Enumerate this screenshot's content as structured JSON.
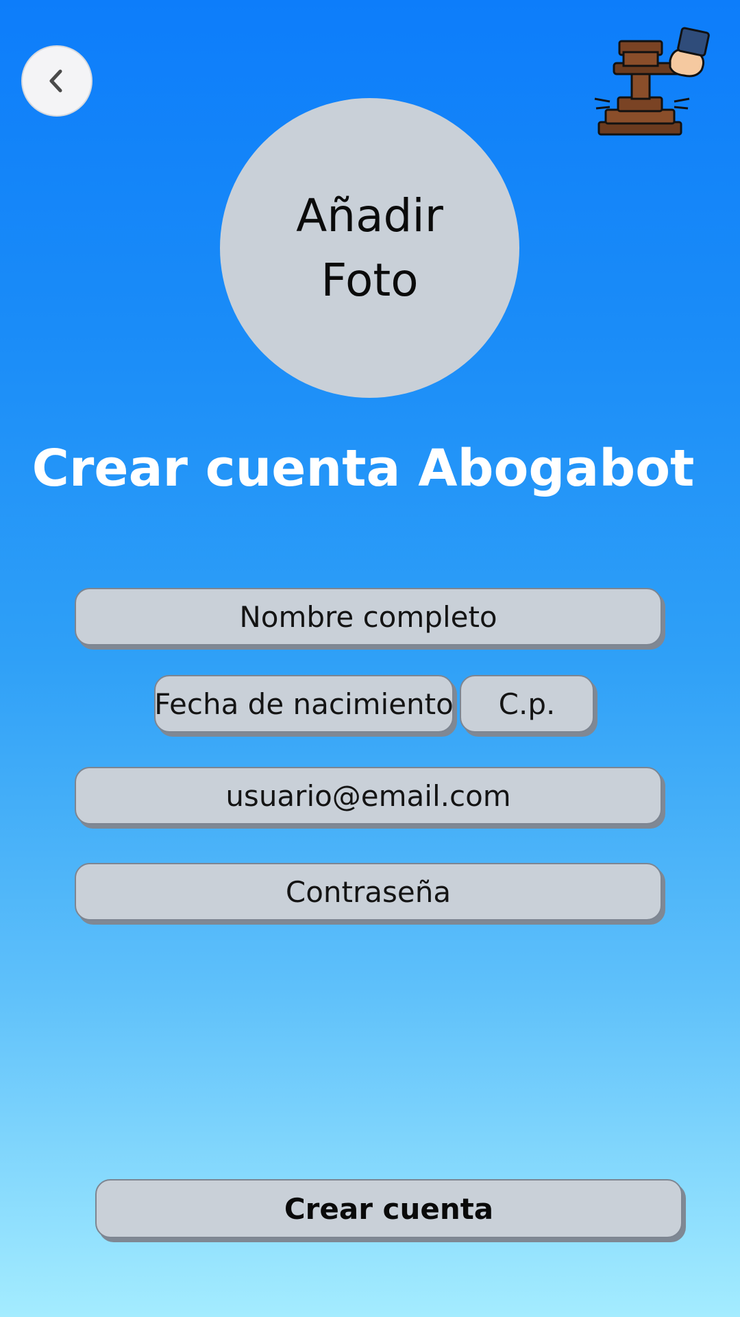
{
  "header": {
    "back_icon": "chevron-left-icon",
    "logo_icon": "gavel-icon"
  },
  "photo": {
    "line1": "Añadir",
    "line2": "Foto"
  },
  "title": "Crear cuenta Abogabot",
  "form": {
    "full_name": "Nombre completo",
    "birth_date": "Fecha de nacimiento",
    "postal_code": "C.p.",
    "email": "usuario@email.com",
    "password": "Contraseña"
  },
  "submit_label": "Crear cuenta",
  "colors": {
    "gradient_top": "#0d7dfa",
    "gradient_bottom": "#a4ecff",
    "field_fill": "#c9d0d8"
  }
}
